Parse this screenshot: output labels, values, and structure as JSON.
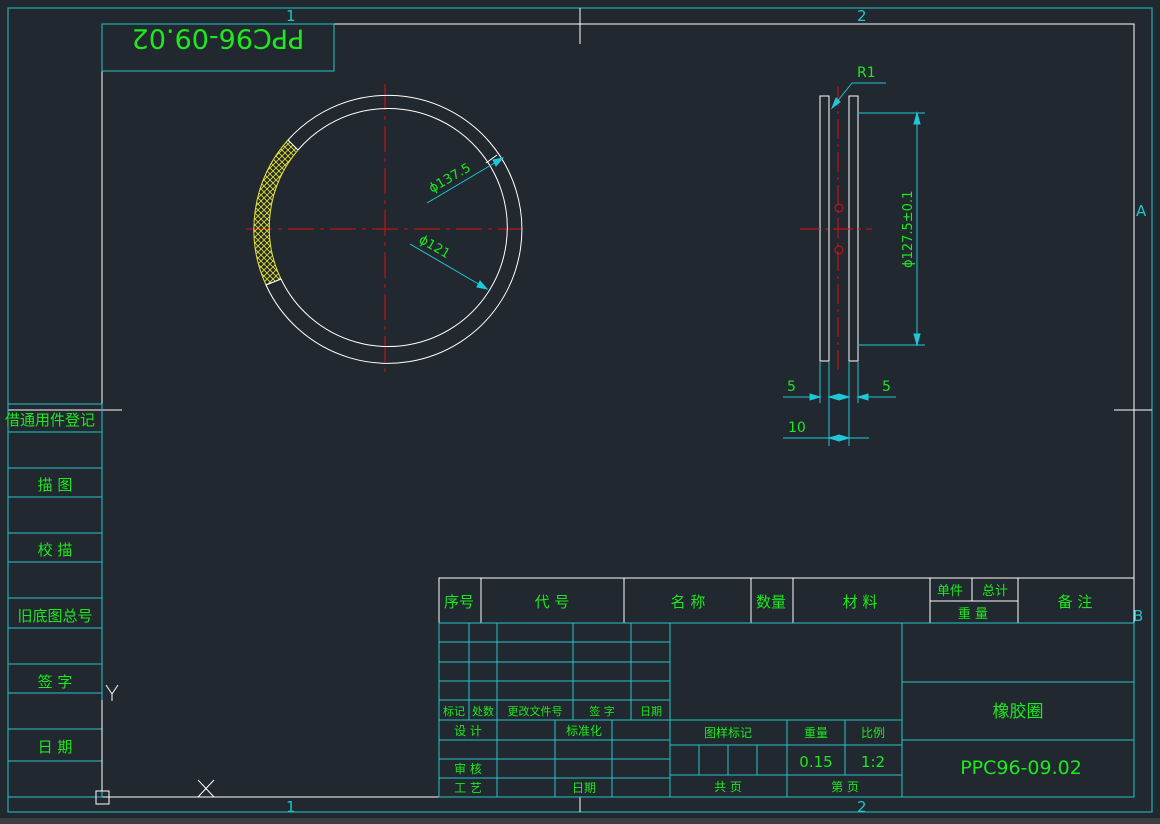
{
  "colors": {
    "background": "#212830",
    "frame": "#ffffff",
    "table_lines": "#22c3c9",
    "text_green": "#1ee81e",
    "dim_lines": "#1fc8d8",
    "centerline": "#e01010",
    "hatch": "#e5e530"
  },
  "zone_labels": {
    "col1": "1",
    "col2": "2",
    "rowA": "A",
    "rowB": "B"
  },
  "mirrored_code": "PPC96-09.02",
  "front_view": {
    "dim_outer": "ϕ137.5",
    "dim_inner": "ϕ121"
  },
  "side_view": {
    "radius": "R1",
    "dim_vertical": "ϕ127.5±0.1",
    "dim_left": "5",
    "dim_right": "5",
    "dim_width": "10"
  },
  "left_strip": [
    "借通用件登记",
    "描 图",
    "校 描",
    "旧底图总号",
    "签 字",
    "日 期"
  ],
  "title_block": {
    "header": {
      "seq": "序号",
      "code": "代 号",
      "name": "名 称",
      "qty": "数量",
      "material": "材 料",
      "unit": "单件",
      "total": "总计",
      "weight": "重 量",
      "remark": "备 注"
    },
    "revision": {
      "mark": "标记",
      "count": "处数",
      "doc": "更改文件号",
      "sign": "签 字",
      "date": "日期"
    },
    "roles": {
      "design": "设 计",
      "standard": "标准化",
      "review": "审 核",
      "process": "工 艺",
      "date": "日期"
    },
    "stage_mark": "图样标记",
    "weight_label": "重量",
    "scale_label": "比例",
    "weight_value": "0.15",
    "scale_value": "1:2",
    "total_sheets": "共 页",
    "sheet_no": "第 页",
    "part_name": "橡胶圈",
    "drawing_no": "PPC96-09.02"
  },
  "ucs": {
    "y_label": "Y"
  }
}
